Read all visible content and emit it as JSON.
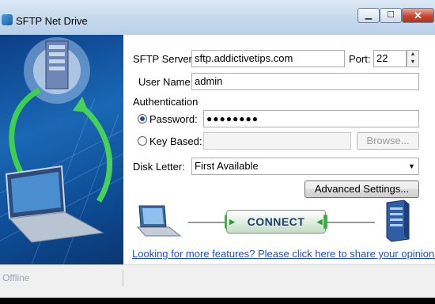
{
  "window": {
    "title": "SFTP Net Drive"
  },
  "title_controls": {
    "minimize": "▁",
    "maximize": "☐",
    "close": "✕"
  },
  "form": {
    "server_label": "SFTP Server",
    "server_value": "sftp.addictivetips.com",
    "port_label": "Port:",
    "port_value": "22",
    "username_label": "User Name:",
    "username_value": "admin",
    "auth_heading": "Authentication",
    "password_label": "Password:",
    "password_value": "●●●●●●●●",
    "password_selected": true,
    "keybased_label": "Key Based:",
    "keybased_value": "",
    "browse_label": "Browse...",
    "disk_label": "Disk Letter:",
    "disk_value": "First Available",
    "advanced_label": "Advanced Settings..."
  },
  "connect": {
    "label": "CONNECT"
  },
  "promo_link": "Looking for more features? Please click here to share your opinion.",
  "status": {
    "text": "Offline"
  },
  "colors": {
    "link": "#1f4fd0",
    "connect_text": "#1d3d70",
    "accent_green": "#2e9b2e",
    "panel_blue": "#1a67b5"
  }
}
